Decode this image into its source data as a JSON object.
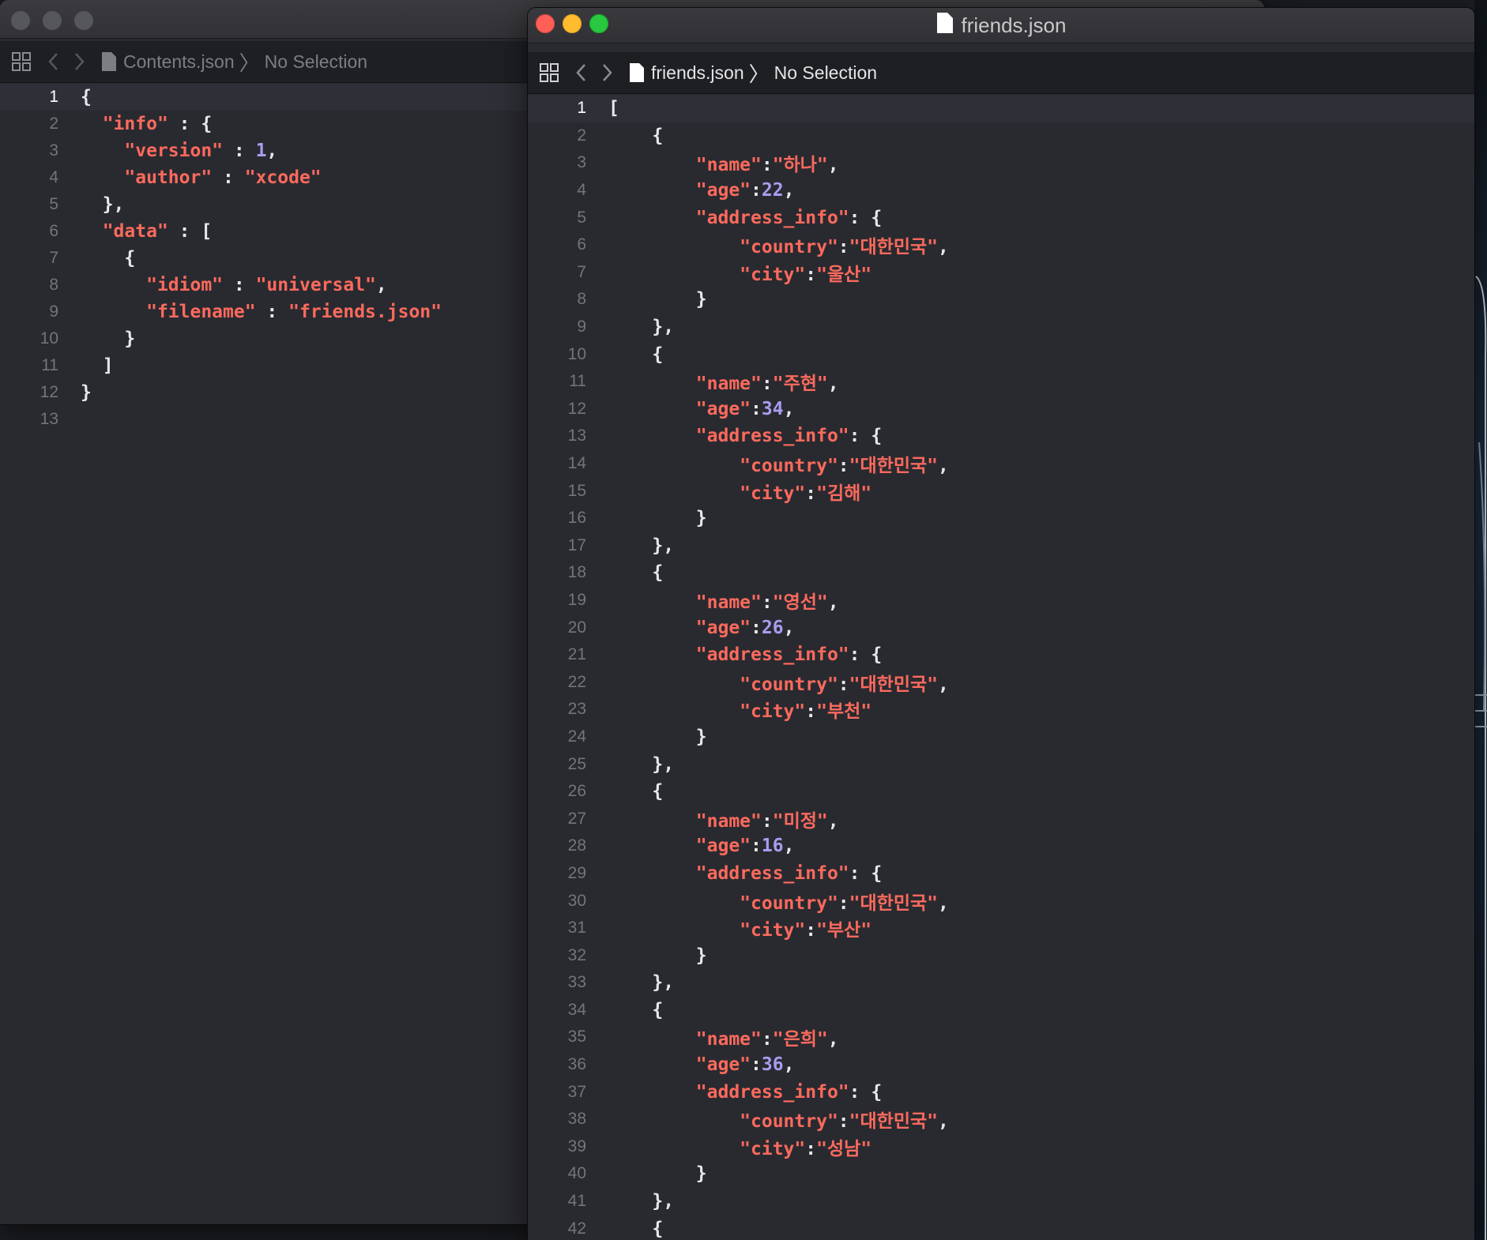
{
  "back_window": {
    "breadcrumb": {
      "file": "Contents.json",
      "selection": "No Selection"
    },
    "icons": [
      "grid-icon",
      "chevron-left-icon",
      "chevron-right-icon",
      "document-icon"
    ],
    "lines": [
      [
        {
          "t": "{",
          "k": "p"
        }
      ],
      [
        {
          "t": "  ",
          "k": "p"
        },
        {
          "t": "\"info\"",
          "k": "key"
        },
        {
          "t": " : {",
          "k": "p"
        }
      ],
      [
        {
          "t": "    ",
          "k": "p"
        },
        {
          "t": "\"version\"",
          "k": "key"
        },
        {
          "t": " : ",
          "k": "p"
        },
        {
          "t": "1",
          "k": "num"
        },
        {
          "t": ",",
          "k": "p"
        }
      ],
      [
        {
          "t": "    ",
          "k": "p"
        },
        {
          "t": "\"author\"",
          "k": "key"
        },
        {
          "t": " : ",
          "k": "p"
        },
        {
          "t": "\"xcode\"",
          "k": "str"
        }
      ],
      [
        {
          "t": "  },",
          "k": "p"
        }
      ],
      [
        {
          "t": "  ",
          "k": "p"
        },
        {
          "t": "\"data\"",
          "k": "key"
        },
        {
          "t": " : [",
          "k": "p"
        }
      ],
      [
        {
          "t": "    {",
          "k": "p"
        }
      ],
      [
        {
          "t": "      ",
          "k": "p"
        },
        {
          "t": "\"idiom\"",
          "k": "key"
        },
        {
          "t": " : ",
          "k": "p"
        },
        {
          "t": "\"universal\"",
          "k": "str"
        },
        {
          "t": ",",
          "k": "p"
        }
      ],
      [
        {
          "t": "      ",
          "k": "p"
        },
        {
          "t": "\"filename\"",
          "k": "key"
        },
        {
          "t": " : ",
          "k": "p"
        },
        {
          "t": "\"friends.json\"",
          "k": "str"
        }
      ],
      [
        {
          "t": "    }",
          "k": "p"
        }
      ],
      [
        {
          "t": "  ]",
          "k": "p"
        }
      ],
      [
        {
          "t": "}",
          "k": "p"
        }
      ],
      []
    ]
  },
  "front_window": {
    "title": "friends.json",
    "breadcrumb": {
      "file": "friends.json",
      "selection": "No Selection"
    },
    "icons": [
      "grid-icon",
      "chevron-left-icon",
      "chevron-right-icon",
      "document-icon"
    ],
    "lines": [
      [
        {
          "t": "[",
          "k": "p"
        }
      ],
      [
        {
          "t": "    {",
          "k": "p"
        }
      ],
      [
        {
          "t": "        ",
          "k": "p"
        },
        {
          "t": "\"name\"",
          "k": "key"
        },
        {
          "t": ":",
          "k": "p"
        },
        {
          "t": "\"하나\"",
          "k": "str"
        },
        {
          "t": ",",
          "k": "p"
        }
      ],
      [
        {
          "t": "        ",
          "k": "p"
        },
        {
          "t": "\"age\"",
          "k": "key"
        },
        {
          "t": ":",
          "k": "p"
        },
        {
          "t": "22",
          "k": "num"
        },
        {
          "t": ",",
          "k": "p"
        }
      ],
      [
        {
          "t": "        ",
          "k": "p"
        },
        {
          "t": "\"address_info\"",
          "k": "key"
        },
        {
          "t": ": {",
          "k": "p"
        }
      ],
      [
        {
          "t": "            ",
          "k": "p"
        },
        {
          "t": "\"country\"",
          "k": "key"
        },
        {
          "t": ":",
          "k": "p"
        },
        {
          "t": "\"대한민국\"",
          "k": "str"
        },
        {
          "t": ",",
          "k": "p"
        }
      ],
      [
        {
          "t": "            ",
          "k": "p"
        },
        {
          "t": "\"city\"",
          "k": "key"
        },
        {
          "t": ":",
          "k": "p"
        },
        {
          "t": "\"울산\"",
          "k": "str"
        }
      ],
      [
        {
          "t": "        }",
          "k": "p"
        }
      ],
      [
        {
          "t": "    },",
          "k": "p"
        }
      ],
      [
        {
          "t": "    {",
          "k": "p"
        }
      ],
      [
        {
          "t": "        ",
          "k": "p"
        },
        {
          "t": "\"name\"",
          "k": "key"
        },
        {
          "t": ":",
          "k": "p"
        },
        {
          "t": "\"주현\"",
          "k": "str"
        },
        {
          "t": ",",
          "k": "p"
        }
      ],
      [
        {
          "t": "        ",
          "k": "p"
        },
        {
          "t": "\"age\"",
          "k": "key"
        },
        {
          "t": ":",
          "k": "p"
        },
        {
          "t": "34",
          "k": "num"
        },
        {
          "t": ",",
          "k": "p"
        }
      ],
      [
        {
          "t": "        ",
          "k": "p"
        },
        {
          "t": "\"address_info\"",
          "k": "key"
        },
        {
          "t": ": {",
          "k": "p"
        }
      ],
      [
        {
          "t": "            ",
          "k": "p"
        },
        {
          "t": "\"country\"",
          "k": "key"
        },
        {
          "t": ":",
          "k": "p"
        },
        {
          "t": "\"대한민국\"",
          "k": "str"
        },
        {
          "t": ",",
          "k": "p"
        }
      ],
      [
        {
          "t": "            ",
          "k": "p"
        },
        {
          "t": "\"city\"",
          "k": "key"
        },
        {
          "t": ":",
          "k": "p"
        },
        {
          "t": "\"김해\"",
          "k": "str"
        }
      ],
      [
        {
          "t": "        }",
          "k": "p"
        }
      ],
      [
        {
          "t": "    },",
          "k": "p"
        }
      ],
      [
        {
          "t": "    {",
          "k": "p"
        }
      ],
      [
        {
          "t": "        ",
          "k": "p"
        },
        {
          "t": "\"name\"",
          "k": "key"
        },
        {
          "t": ":",
          "k": "p"
        },
        {
          "t": "\"영선\"",
          "k": "str"
        },
        {
          "t": ",",
          "k": "p"
        }
      ],
      [
        {
          "t": "        ",
          "k": "p"
        },
        {
          "t": "\"age\"",
          "k": "key"
        },
        {
          "t": ":",
          "k": "p"
        },
        {
          "t": "26",
          "k": "num"
        },
        {
          "t": ",",
          "k": "p"
        }
      ],
      [
        {
          "t": "        ",
          "k": "p"
        },
        {
          "t": "\"address_info\"",
          "k": "key"
        },
        {
          "t": ": {",
          "k": "p"
        }
      ],
      [
        {
          "t": "            ",
          "k": "p"
        },
        {
          "t": "\"country\"",
          "k": "key"
        },
        {
          "t": ":",
          "k": "p"
        },
        {
          "t": "\"대한민국\"",
          "k": "str"
        },
        {
          "t": ",",
          "k": "p"
        }
      ],
      [
        {
          "t": "            ",
          "k": "p"
        },
        {
          "t": "\"city\"",
          "k": "key"
        },
        {
          "t": ":",
          "k": "p"
        },
        {
          "t": "\"부천\"",
          "k": "str"
        }
      ],
      [
        {
          "t": "        }",
          "k": "p"
        }
      ],
      [
        {
          "t": "    },",
          "k": "p"
        }
      ],
      [
        {
          "t": "    {",
          "k": "p"
        }
      ],
      [
        {
          "t": "        ",
          "k": "p"
        },
        {
          "t": "\"name\"",
          "k": "key"
        },
        {
          "t": ":",
          "k": "p"
        },
        {
          "t": "\"미정\"",
          "k": "str"
        },
        {
          "t": ",",
          "k": "p"
        }
      ],
      [
        {
          "t": "        ",
          "k": "p"
        },
        {
          "t": "\"age\"",
          "k": "key"
        },
        {
          "t": ":",
          "k": "p"
        },
        {
          "t": "16",
          "k": "num"
        },
        {
          "t": ",",
          "k": "p"
        }
      ],
      [
        {
          "t": "        ",
          "k": "p"
        },
        {
          "t": "\"address_info\"",
          "k": "key"
        },
        {
          "t": ": {",
          "k": "p"
        }
      ],
      [
        {
          "t": "            ",
          "k": "p"
        },
        {
          "t": "\"country\"",
          "k": "key"
        },
        {
          "t": ":",
          "k": "p"
        },
        {
          "t": "\"대한민국\"",
          "k": "str"
        },
        {
          "t": ",",
          "k": "p"
        }
      ],
      [
        {
          "t": "            ",
          "k": "p"
        },
        {
          "t": "\"city\"",
          "k": "key"
        },
        {
          "t": ":",
          "k": "p"
        },
        {
          "t": "\"부산\"",
          "k": "str"
        }
      ],
      [
        {
          "t": "        }",
          "k": "p"
        }
      ],
      [
        {
          "t": "    },",
          "k": "p"
        }
      ],
      [
        {
          "t": "    {",
          "k": "p"
        }
      ],
      [
        {
          "t": "        ",
          "k": "p"
        },
        {
          "t": "\"name\"",
          "k": "key"
        },
        {
          "t": ":",
          "k": "p"
        },
        {
          "t": "\"은희\"",
          "k": "str"
        },
        {
          "t": ",",
          "k": "p"
        }
      ],
      [
        {
          "t": "        ",
          "k": "p"
        },
        {
          "t": "\"age\"",
          "k": "key"
        },
        {
          "t": ":",
          "k": "p"
        },
        {
          "t": "36",
          "k": "num"
        },
        {
          "t": ",",
          "k": "p"
        }
      ],
      [
        {
          "t": "        ",
          "k": "p"
        },
        {
          "t": "\"address_info\"",
          "k": "key"
        },
        {
          "t": ": {",
          "k": "p"
        }
      ],
      [
        {
          "t": "            ",
          "k": "p"
        },
        {
          "t": "\"country\"",
          "k": "key"
        },
        {
          "t": ":",
          "k": "p"
        },
        {
          "t": "\"대한민국\"",
          "k": "str"
        },
        {
          "t": ",",
          "k": "p"
        }
      ],
      [
        {
          "t": "            ",
          "k": "p"
        },
        {
          "t": "\"city\"",
          "k": "key"
        },
        {
          "t": ":",
          "k": "p"
        },
        {
          "t": "\"성남\"",
          "k": "str"
        }
      ],
      [
        {
          "t": "        }",
          "k": "p"
        }
      ],
      [
        {
          "t": "    },",
          "k": "p"
        }
      ],
      [
        {
          "t": "    {",
          "k": "p"
        }
      ]
    ]
  },
  "colors": {
    "editor_bg": "#292a30",
    "key_string": "#fc6a5d",
    "number": "#a79df0",
    "punct": "#e8e8ea",
    "close": "#fe5f57",
    "minimize": "#febc2e",
    "zoom": "#28c840"
  }
}
